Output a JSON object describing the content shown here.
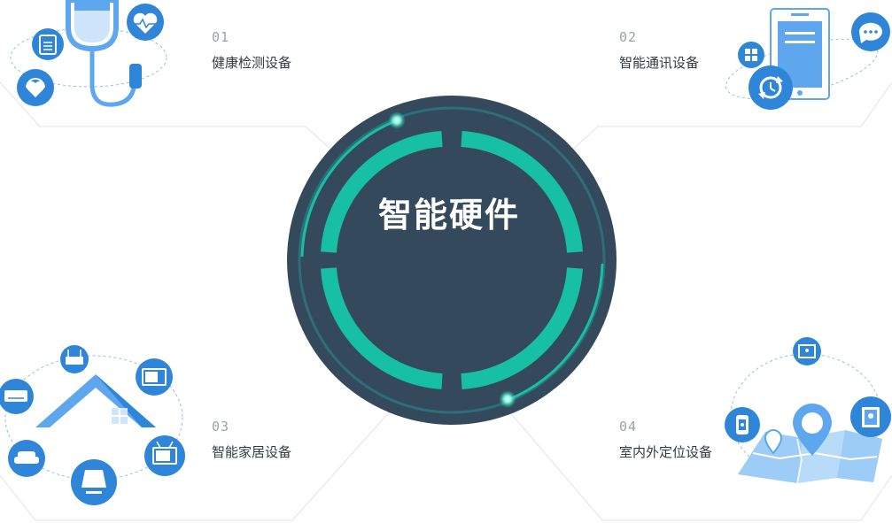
{
  "center": {
    "title": "智能硬件"
  },
  "items": [
    {
      "num": "01",
      "label": "健康检测设备"
    },
    {
      "num": "02",
      "label": "智能通讯设备"
    },
    {
      "num": "03",
      "label": "智能家居设备"
    },
    {
      "num": "04",
      "label": "室内外定位设备"
    }
  ],
  "colors": {
    "circle_bg": "#34495b",
    "ring_teal": "#17bfa4",
    "icon_blue": "#2f86d9",
    "light_blue": "#5ea6ee",
    "frame_line": "#dfe4e8"
  }
}
